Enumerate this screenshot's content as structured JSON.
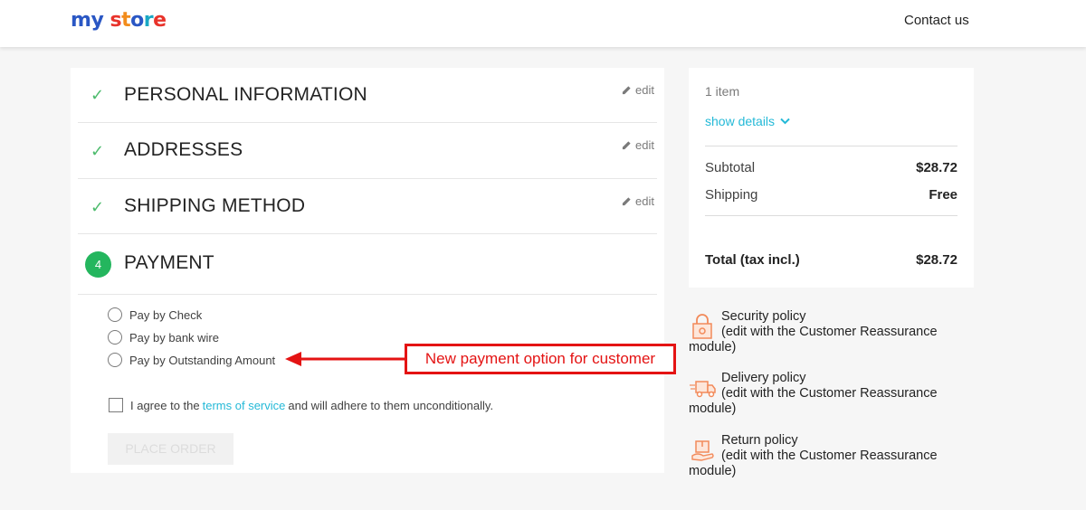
{
  "header": {
    "logo": {
      "letters": [
        "m",
        "y",
        " ",
        "s",
        "t",
        "o",
        "r",
        "e"
      ],
      "colors": [
        "#2a57c4",
        "#2a57c4",
        "",
        "#e8332b",
        "#f28c1c",
        "#2a57c4",
        "#1aa8c4",
        "#e8332b"
      ]
    },
    "contact": "Contact us"
  },
  "steps": [
    {
      "title": "PERSONAL INFORMATION",
      "edit": "edit"
    },
    {
      "title": "ADDRESSES",
      "edit": "edit"
    },
    {
      "title": "SHIPPING METHOD",
      "edit": "edit"
    }
  ],
  "payment": {
    "number": "4",
    "title": "PAYMENT",
    "options": [
      "Pay by Check",
      "Pay by bank wire",
      "Pay by Outstanding Amount"
    ],
    "agree_prefix": "I agree to the",
    "terms_link": "terms of service",
    "agree_suffix": "and will adhere to them unconditionally.",
    "place_order": "PLACE ORDER"
  },
  "annotation": "New payment option for customer",
  "summary": {
    "items": "1 item",
    "show_details": "show details",
    "subtotal_label": "Subtotal",
    "subtotal_value": "$28.72",
    "shipping_label": "Shipping",
    "shipping_value": "Free",
    "total_label": "Total (tax incl.)",
    "total_value": "$28.72"
  },
  "reassurance": [
    {
      "title": "Security policy",
      "sub": "(edit with the Customer Reassurance",
      "wrap": "module)",
      "icon": "lock-icon"
    },
    {
      "title": "Delivery policy",
      "sub": "(edit with the Customer Reassurance",
      "wrap": "module)",
      "icon": "delivery-truck-icon"
    },
    {
      "title": "Return policy",
      "sub": "(edit with the Customer Reassurance",
      "wrap": "module)",
      "icon": "return-box-icon"
    }
  ],
  "colors": {
    "accent": "#24b9d7",
    "success": "#24b65e",
    "annotation": "#e41313"
  }
}
